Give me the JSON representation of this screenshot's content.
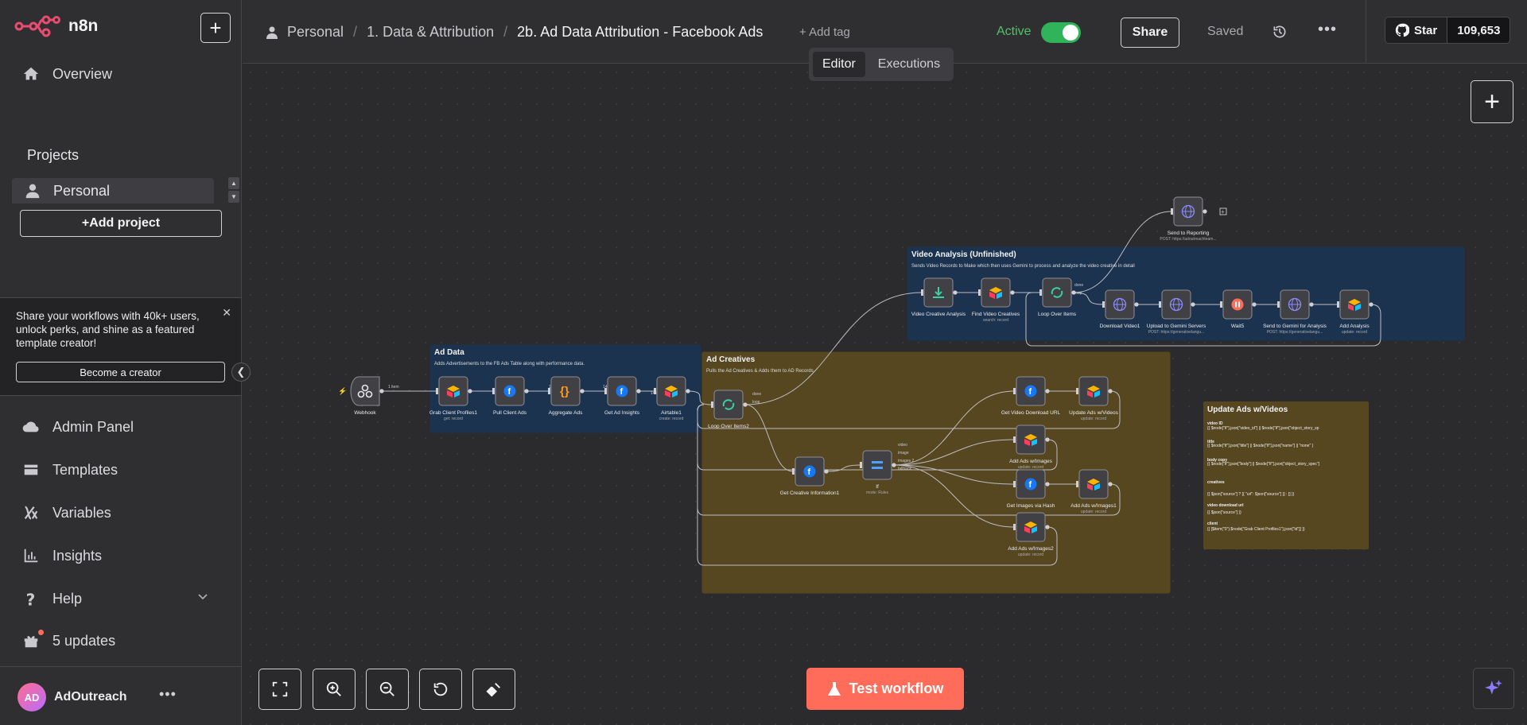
{
  "app": {
    "logo_text": "n8n"
  },
  "sidebar": {
    "overview_label": "Overview",
    "projects_heading": "Projects",
    "project_item": "Personal",
    "add_project_label": "Add project",
    "promo": {
      "text": "Share your workflows with 40k+ users, unlock perks, and shine as a featured template creator!",
      "button_label": "Become a creator"
    },
    "items": [
      {
        "label": "Admin Panel",
        "icon": "cloud-icon"
      },
      {
        "label": "Templates",
        "icon": "templates-icon"
      },
      {
        "label": "Variables",
        "icon": "variables-icon"
      },
      {
        "label": "Insights",
        "icon": "insights-icon"
      },
      {
        "label": "Help",
        "icon": "help-icon"
      },
      {
        "label": "5 updates",
        "icon": "gift-icon"
      }
    ],
    "user": {
      "initials": "AD",
      "name": "AdOutreach"
    }
  },
  "header": {
    "breadcrumb": [
      "Personal",
      "1. Data & Attribution",
      "2b. Ad Data Attribution - Facebook Ads"
    ],
    "add_tag": "+ Add tag",
    "active_label": "Active",
    "active": true,
    "share_label": "Share",
    "saved_label": "Saved",
    "github": {
      "star_label": "Star",
      "count": "109,653"
    },
    "tabs": [
      "Editor",
      "Executions"
    ],
    "active_tab": "Editor"
  },
  "canvas": {
    "test_button_label": "Test workflow",
    "groups": [
      {
        "title": "Ad Data",
        "desc": "Adds Advertisements to the FB Ads Table along with performance data.",
        "color": "#1c3350"
      },
      {
        "title": "Ad Creatives",
        "desc": "Pulls the Ad Creatives & Adds them to AD Records",
        "color": "#564720"
      },
      {
        "title": "Video Analysis (Unfinished)",
        "desc": "Sends Video Records to Make which then uses Gemini to process and analyze the video creative in detail",
        "color": "#1c3350"
      }
    ],
    "note": {
      "title": "Update Ads w/Videos",
      "lines": [
        "video ID",
        "{{ $node[\"If\"].json[\"video_id\"] || $node[\"If\"].json[\"object_story_spec\"][\"video_data\"][\"video_id\"] || \"none\" }}",
        "title",
        "{{ $node[\"If\"].json[\"title\"] || $node[\"If\"].json[\"name\"] || \"none\" }}",
        "body copy",
        "{{ $node[\"If\"].json[\"body\"] || $node[\"If\"].json[\"object_story_spec\"][\"video_data\"][\"message\"] || \"none\" }}",
        "creatives",
        "{{ $json[\"source\"] ? [{ \"url\": $json[\"source\"] }] : [] }}",
        "video download url",
        "{{ $json[\"source\"] }}",
        "client",
        "{{ [$item(\"0\").$node[\"Grab Client Profiles1\"].json[\"id\"]] }}"
      ]
    },
    "nodes": [
      {
        "id": "webhook",
        "label": "Webhook",
        "icon": "webhook-icon"
      },
      {
        "id": "grab",
        "label": "Grab Client Profiles1",
        "sub": "get: record",
        "icon": "airtable-icon"
      },
      {
        "id": "pull",
        "label": "Pull Client Ads",
        "icon": "facebook-icon"
      },
      {
        "id": "agg",
        "label": "Aggregate Ads",
        "icon": "code-icon"
      },
      {
        "id": "insights",
        "label": "Get Ad Insights",
        "icon": "facebook-icon"
      },
      {
        "id": "at1",
        "label": "Airtable1",
        "sub": "create: record",
        "icon": "airtable-icon"
      },
      {
        "id": "loop2",
        "label": "Loop Over Items2",
        "icon": "loop-icon"
      },
      {
        "id": "gci",
        "label": "Get Creative Information1",
        "icon": "facebook-icon"
      },
      {
        "id": "if",
        "label": "If",
        "sub": "mode: Rules",
        "icon": "switch-icon"
      },
      {
        "id": "gvdu",
        "label": "Get Video Download URL",
        "icon": "facebook-icon"
      },
      {
        "id": "uav",
        "label": "Update Ads w/Videos",
        "sub": "update: record",
        "icon": "airtable-icon"
      },
      {
        "id": "aai",
        "label": "Add Ads w/Images",
        "sub": "update: record",
        "icon": "airtable-icon"
      },
      {
        "id": "givh",
        "label": "Get Images via Hash",
        "icon": "facebook-icon"
      },
      {
        "id": "aai1",
        "label": "Add Ads w/Images1",
        "sub": "update: record",
        "icon": "airtable-icon"
      },
      {
        "id": "aai2",
        "label": "Add Ads w/Images2",
        "sub": "update: record",
        "icon": "airtable-icon"
      },
      {
        "id": "vca",
        "label": "Video Creative Analysis",
        "icon": "download-icon"
      },
      {
        "id": "fvc",
        "label": "Find Video Creatives",
        "sub": "search: record",
        "icon": "airtable-icon"
      },
      {
        "id": "loop",
        "label": "Loop Over Items",
        "icon": "loop-icon"
      },
      {
        "id": "dv1",
        "label": "Download Video1",
        "icon": "globe-icon"
      },
      {
        "id": "ugs",
        "label": "Upload to Gemini Servers",
        "sub": "POST: https://generativelangu...",
        "icon": "globe-icon"
      },
      {
        "id": "wait5",
        "label": "Wait5",
        "icon": "pause-icon"
      },
      {
        "id": "sga",
        "label": "Send to Gemini for Analysis",
        "sub": "POST: https://generativelangu...",
        "icon": "globe-icon"
      },
      {
        "id": "aa",
        "label": "Add Analysis",
        "sub": "update: record",
        "icon": "airtable-icon"
      },
      {
        "id": "str",
        "label": "Send to Reporting",
        "sub": "POST: https://adoutreachteam...",
        "icon": "globe-icon"
      }
    ],
    "edge_labels": [
      "1 item",
      "1 item",
      "1 item",
      "14 items",
      "14 items",
      "14 items",
      "done",
      "loop",
      "video",
      "image",
      "images 2",
      "fallback",
      "done",
      "loop"
    ]
  }
}
